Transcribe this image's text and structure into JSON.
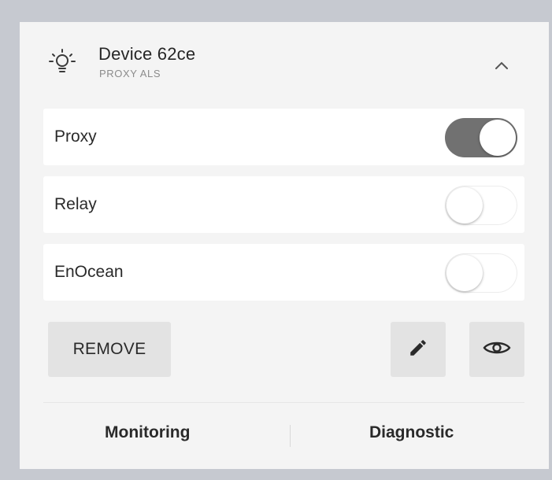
{
  "device": {
    "name": "Device 62ce",
    "type": "PROXY ALS",
    "icon": "lightbulb-icon",
    "collapse_icon": "chevron-up-icon"
  },
  "features": [
    {
      "label": "Proxy",
      "enabled": true
    },
    {
      "label": "Relay",
      "enabled": false
    },
    {
      "label": "EnOcean",
      "enabled": false
    }
  ],
  "actions": {
    "remove_label": "REMOVE",
    "edit_icon": "pencil-icon",
    "view_icon": "eye-icon"
  },
  "footer": {
    "monitoring_label": "Monitoring",
    "diagnostic_label": "Diagnostic"
  },
  "colors": {
    "toggle_on": "#717171",
    "button_bg": "#e3e3e3",
    "panel_bg": "#f4f4f4",
    "frame_bg": "#c6c9d0"
  }
}
